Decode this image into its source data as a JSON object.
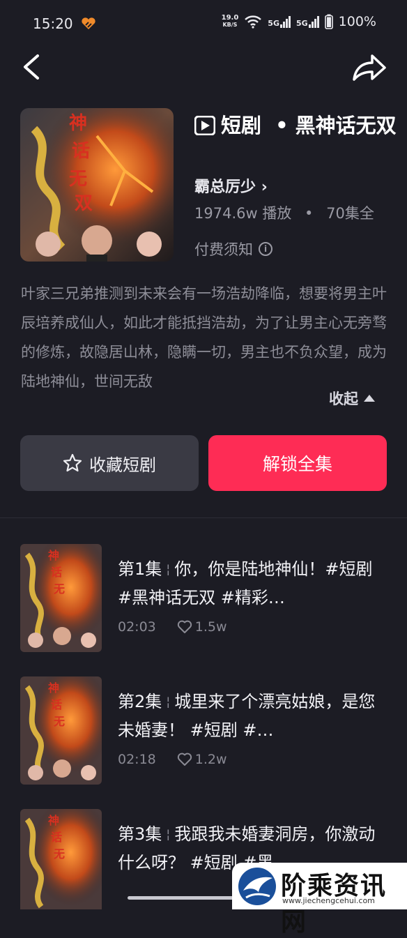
{
  "status": {
    "time": "15:20",
    "speed_value": "19.0",
    "speed_unit": "KB/S",
    "net1": "5G",
    "net2": "5G",
    "battery": "100%"
  },
  "drama": {
    "category": "短剧",
    "dot": "•",
    "title": "黑神话无双",
    "author": "霸总厉少",
    "author_arrow": "›",
    "plays": "1974.6w 播放",
    "stat_dot": "•",
    "episodes_total": "70集全",
    "fee_notice": "付费须知",
    "fee_info_glyph": "i",
    "synopsis": "叶家三兄弟推测到未来会有一场浩劫降临，想要将男主叶辰培养成仙人，如此才能抵挡浩劫，为了让男主心无旁骛的修炼，故隐居山林，隐瞒一切，男主也不负众望，成为陆地神仙，世间无敌",
    "collapse": "收起"
  },
  "actions": {
    "favorite": "收藏短剧",
    "unlock": "解锁全集"
  },
  "episodes": [
    {
      "num": "第1集",
      "sep": "¦",
      "title": "你，你是陆地神仙！#短剧 #黑神话无双 #精彩…",
      "duration": "02:03",
      "likes": "1.5w"
    },
    {
      "num": "第2集",
      "sep": "¦",
      "title": "城里来了个漂亮姑娘，是您未婚妻！ #短剧 #…",
      "duration": "02:18",
      "likes": "1.2w"
    },
    {
      "num": "第3集",
      "sep": "¦",
      "title": "我跟我未婚妻洞房，你激动什么呀？ #短剧 #黑…",
      "duration": "",
      "likes": ""
    }
  ],
  "watermark": {
    "title": "阶乘资讯网",
    "url": "www.jiechengcehui.com"
  },
  "colors": {
    "background": "#1c1c24",
    "accent": "#fe2c55",
    "secondary_button": "#3a3a44"
  }
}
